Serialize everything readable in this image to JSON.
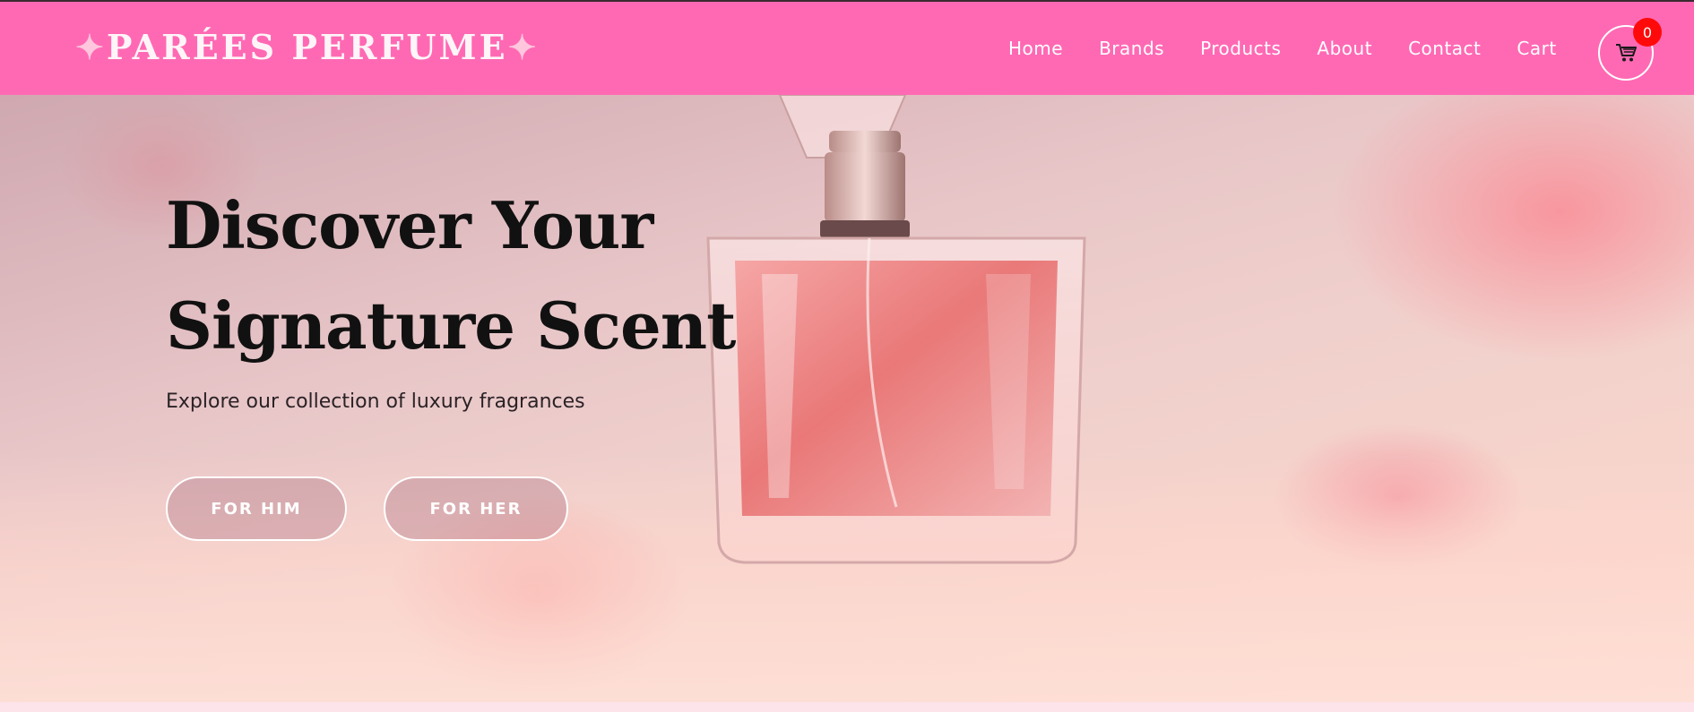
{
  "brand": {
    "logo_text": "PARÉES PERFUME",
    "star_glyph": "✦"
  },
  "nav": {
    "links": [
      "Home",
      "Brands",
      "Products",
      "About",
      "Contact",
      "Cart"
    ],
    "cart_count": "0",
    "cart_icon": "shopping-cart-icon"
  },
  "hero": {
    "headline": "Discover Your Signature Scent",
    "subline": "Explore our collection of luxury fragrances",
    "buttons": {
      "for_him": "FOR HIM",
      "for_her": "FOR HER"
    }
  },
  "colors": {
    "nav_bg": "#ff69b4",
    "badge_red": "#ff0a0a",
    "page_bg": "#fde4ea",
    "headline": "#111111"
  }
}
